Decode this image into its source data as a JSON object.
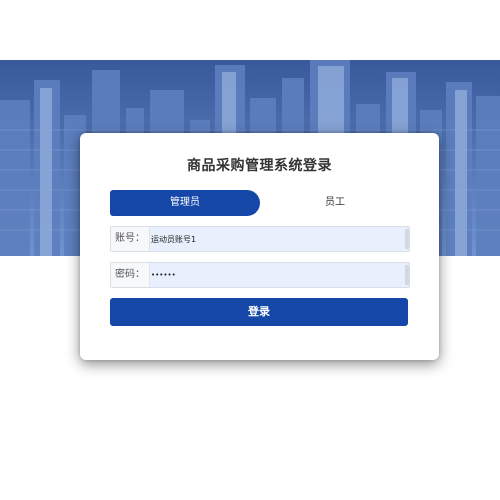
{
  "login": {
    "title": "商品采购管理系统登录",
    "tabs": [
      "管理员",
      "员工"
    ],
    "active_tab": "管理员",
    "account_label": "账号：",
    "account_value": "运动员账号1",
    "password_label": "密码：",
    "password_value": "••••••",
    "submit_label": "登录"
  },
  "colors": {
    "accent": "#1547a8",
    "input_bg": "#e8f0fe"
  }
}
